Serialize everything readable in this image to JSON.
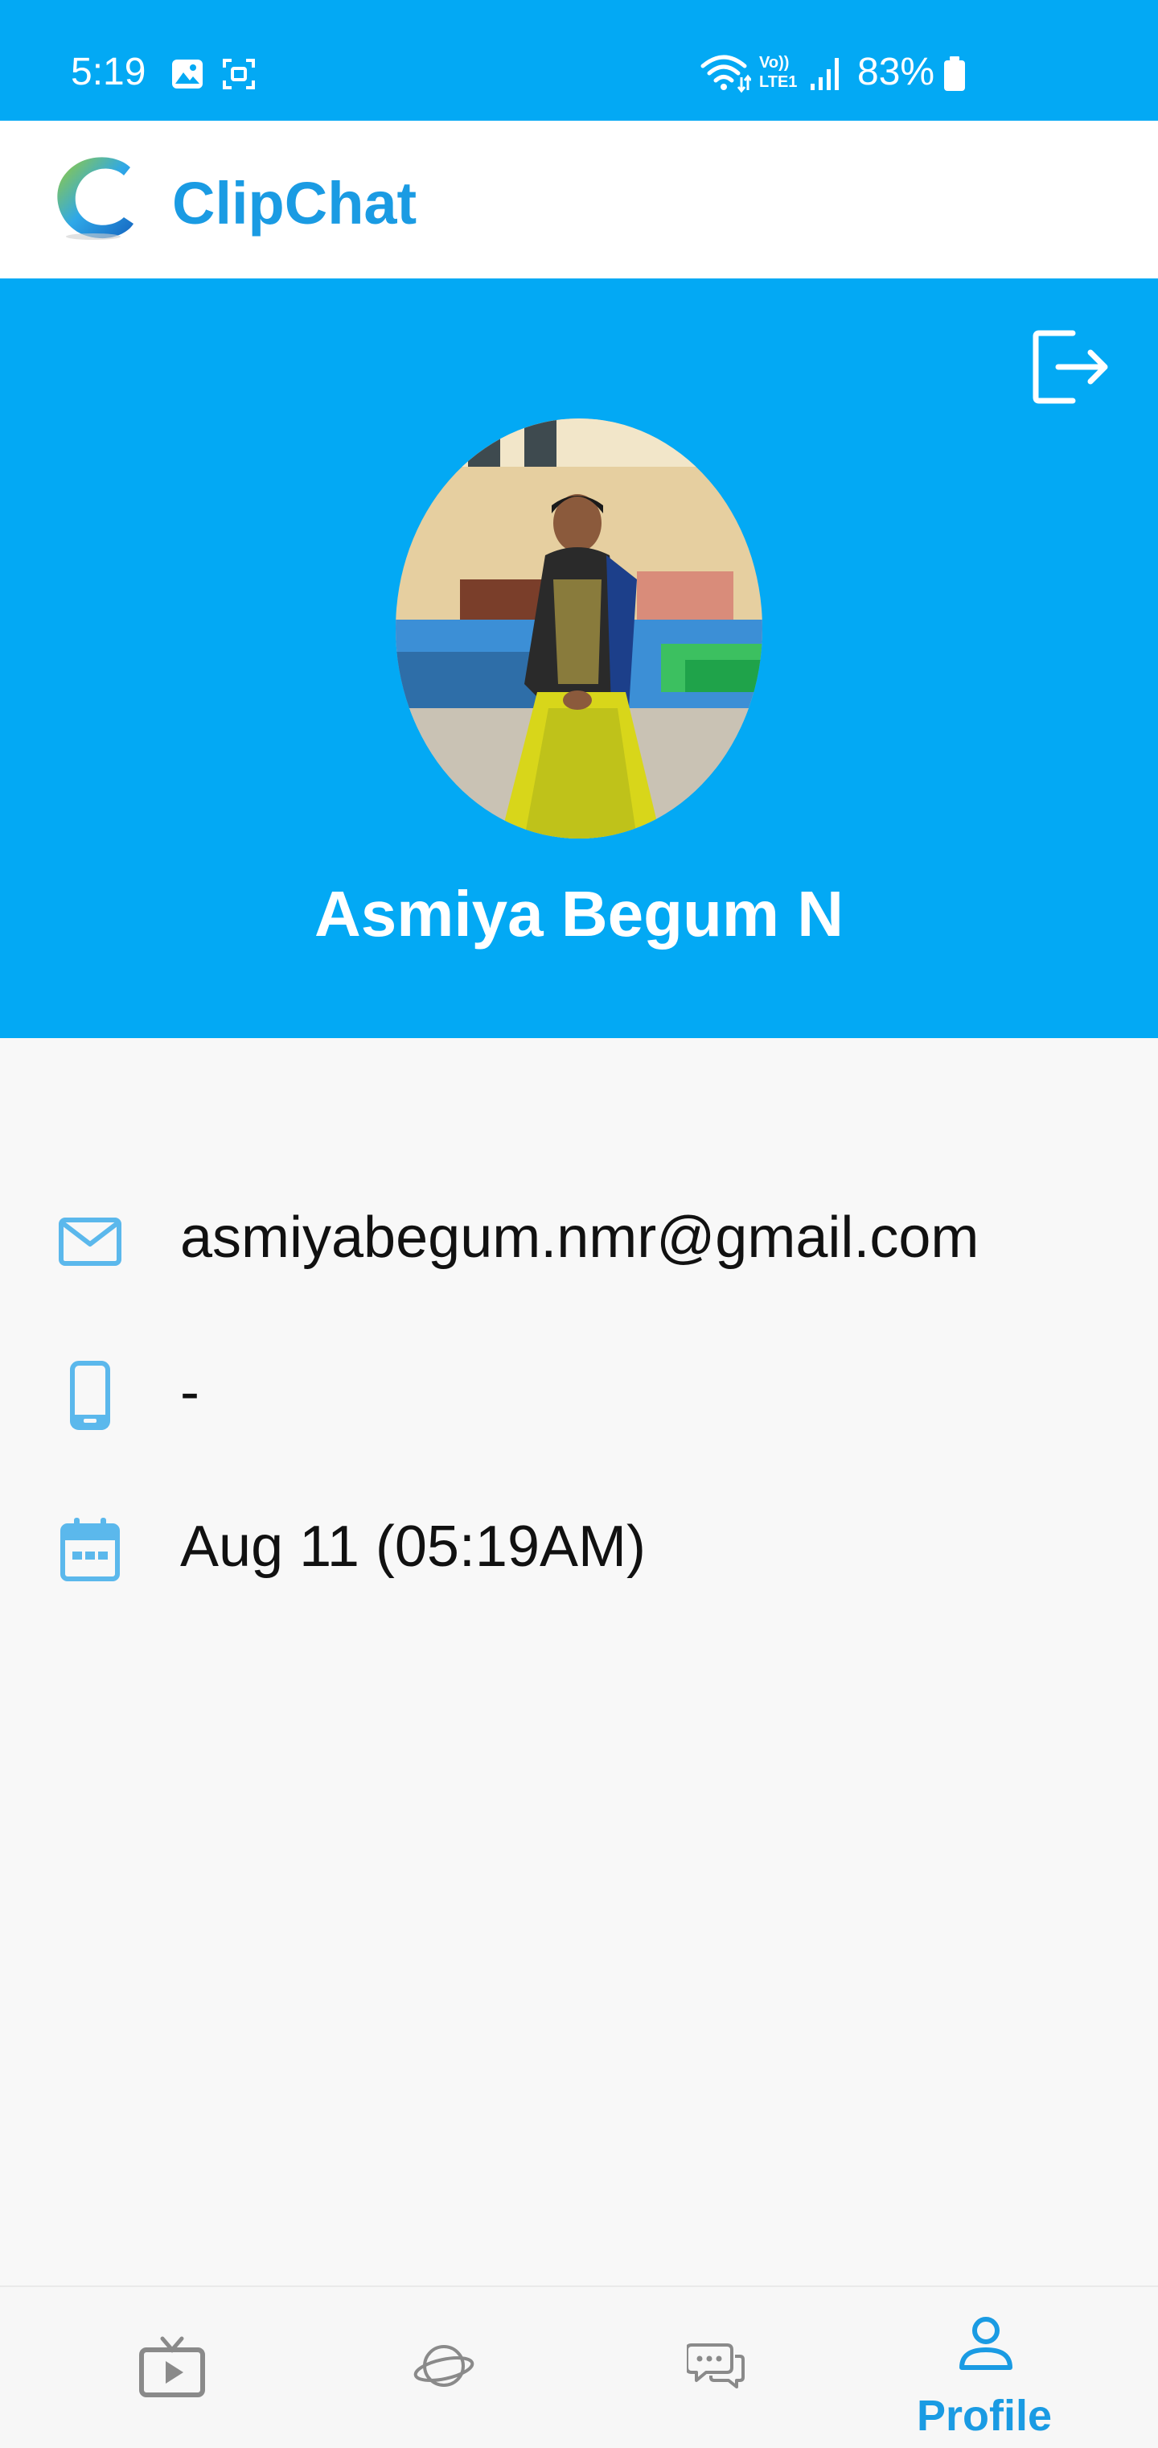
{
  "status_bar": {
    "time": "5:19",
    "battery": "83%",
    "network_label": "Vo)) LTE1"
  },
  "app_bar": {
    "title": "ClipChat",
    "logo_icon": "clipchat-logo"
  },
  "profile": {
    "name": "Asmiya Begum N",
    "logout_icon": "logout-icon"
  },
  "info": {
    "email": "asmiyabegum.nmr@gmail.com",
    "phone": "-",
    "date": "Aug 11 (05:19AM)",
    "email_icon": "mail-icon",
    "phone_icon": "phone-icon",
    "date_icon": "calendar-icon"
  },
  "bottom_nav": {
    "items": [
      {
        "icon": "tv-play-icon",
        "label": ""
      },
      {
        "icon": "planet-icon",
        "label": ""
      },
      {
        "icon": "chat-bubbles-icon",
        "label": ""
      },
      {
        "icon": "person-icon",
        "label": "Profile",
        "active": true
      }
    ]
  },
  "colors": {
    "primary": "#03A9F4",
    "accent": "#1A9BE3",
    "icon_light": "#5BB8EC",
    "nav_inactive": "#8a8a8a"
  }
}
